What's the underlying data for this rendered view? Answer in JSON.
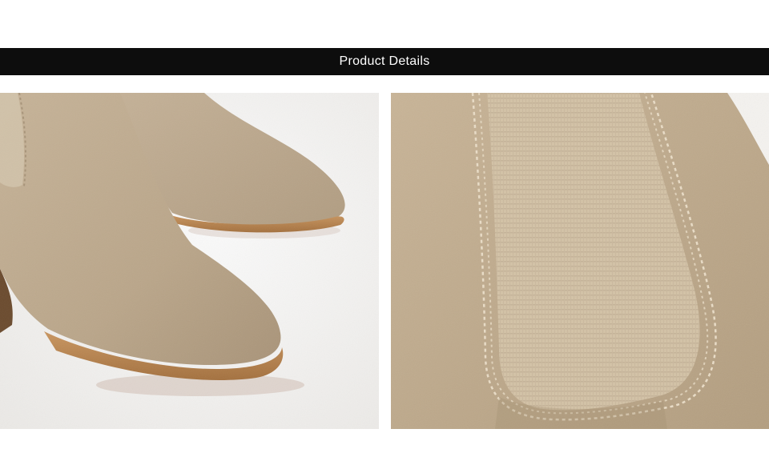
{
  "header": {
    "title": "Product Details"
  },
  "images": [
    {
      "subject": "suede-boot-toe-pair"
    },
    {
      "subject": "elastic-side-panel-closeup"
    }
  ],
  "colors": {
    "header_bg": "#0d0d0d",
    "header_text": "#ffffff",
    "suede": "#bfab8e",
    "sole": "#c08a55",
    "background": "#ffffff"
  }
}
